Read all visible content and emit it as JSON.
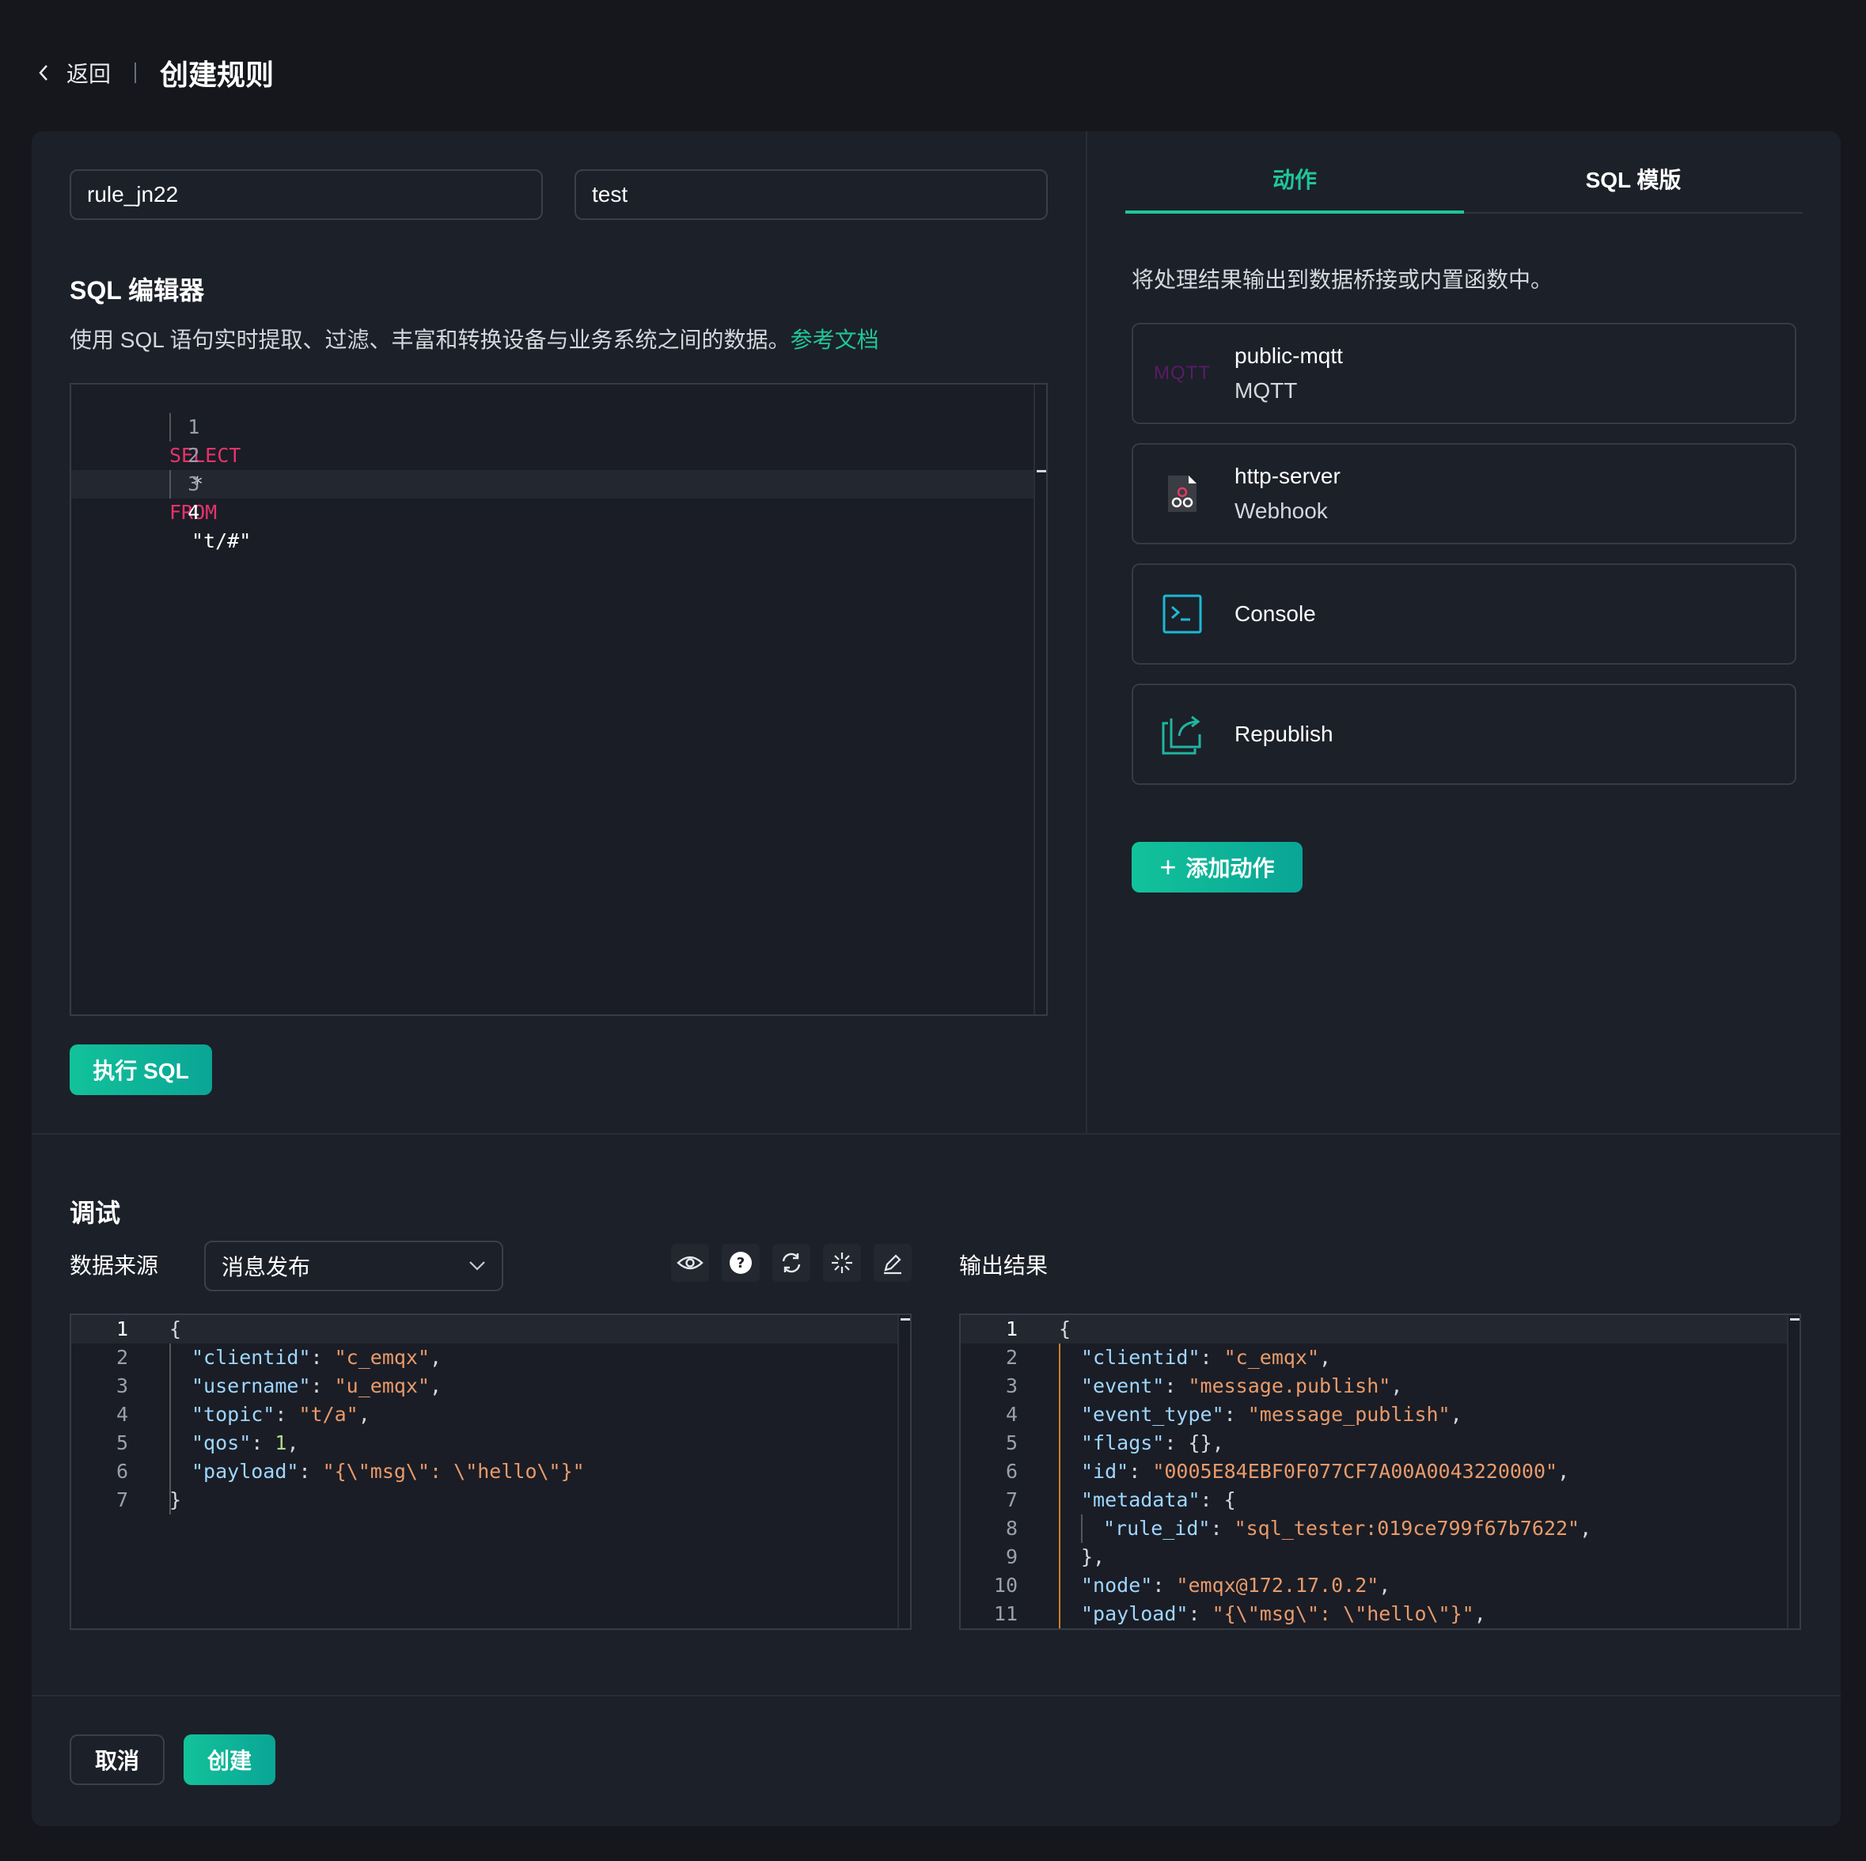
{
  "header": {
    "back_label": "返回",
    "title": "创建规则"
  },
  "rule": {
    "id": "rule_jn22",
    "description": "test"
  },
  "sql_editor": {
    "title": "SQL 编辑器",
    "description": "使用 SQL 语句实时提取、过滤、丰富和转换设备与业务系统之间的数据。",
    "doc_link": "参考文档",
    "lines": [
      {
        "n": "1",
        "text": "SELECT"
      },
      {
        "n": "2",
        "text": "*"
      },
      {
        "n": "3",
        "text": "FROM"
      },
      {
        "n": "4",
        "text": "\"t/#\""
      }
    ],
    "run_label": "执行 SQL"
  },
  "tabs": [
    {
      "label": "动作"
    },
    {
      "label": "SQL 模版"
    }
  ],
  "actions": {
    "description": "将处理结果输出到数据桥接或内置函数中。",
    "items": [
      {
        "name": "public-mqtt",
        "type": "MQTT",
        "icon_text": "MQTT",
        "icon": "mqtt-icon"
      },
      {
        "name": "http-server",
        "type": "Webhook",
        "icon": "webhook-icon"
      },
      {
        "name": "Console",
        "type": "",
        "icon": "terminal-icon"
      },
      {
        "name": "Republish",
        "type": "",
        "icon": "republish-icon"
      }
    ],
    "add_label": "添加动作"
  },
  "debug": {
    "title": "调试",
    "source_label": "数据来源",
    "source_value": "消息发布",
    "output_label": "输出结果",
    "input_lines": [
      {
        "n": "1",
        "key": "",
        "val": "",
        "raw": "{"
      },
      {
        "n": "2",
        "key": "\"clientid\"",
        "val": "\"c_emqx\"",
        "raw": ""
      },
      {
        "n": "3",
        "key": "\"username\"",
        "val": "\"u_emqx\"",
        "raw": ""
      },
      {
        "n": "4",
        "key": "\"topic\"",
        "val": "\"t/a\"",
        "raw": ""
      },
      {
        "n": "5",
        "key": "\"qos\"",
        "val": "1",
        "raw": ""
      },
      {
        "n": "6",
        "key": "\"payload\"",
        "val": "\"{\\\"msg\\\": \\\"hello\\\"}\"",
        "raw": ""
      },
      {
        "n": "7",
        "key": "",
        "val": "",
        "raw": "}"
      }
    ],
    "output_lines": [
      {
        "n": "1",
        "key": "",
        "val": "",
        "raw": "{"
      },
      {
        "n": "2",
        "key": "\"clientid\"",
        "val": "\"c_emqx\"",
        "raw": ""
      },
      {
        "n": "3",
        "key": "\"event\"",
        "val": "\"message.publish\"",
        "raw": ""
      },
      {
        "n": "4",
        "key": "\"event_type\"",
        "val": "\"message_publish\"",
        "raw": ""
      },
      {
        "n": "5",
        "key": "\"flags\"",
        "val": "{}",
        "raw": ""
      },
      {
        "n": "6",
        "key": "\"id\"",
        "val": "\"0005E84EBF0F077CF7A00A0043220000\"",
        "raw": ""
      },
      {
        "n": "7",
        "key": "\"metadata\"",
        "val": "{",
        "raw": ""
      },
      {
        "n": "8",
        "key": "\"rule_id\"",
        "val": "\"sql_tester:019ce799f67b7622\"",
        "raw": ""
      },
      {
        "n": "9",
        "key": "",
        "val": "",
        "raw": "},"
      },
      {
        "n": "10",
        "key": "\"node\"",
        "val": "\"emqx@172.17.0.2\"",
        "raw": ""
      },
      {
        "n": "11",
        "key": "\"payload\"",
        "val": "\"{\\\"msg\\\": \\\"hello\\\"}\"",
        "raw": ""
      }
    ]
  },
  "footer": {
    "cancel_label": "取消",
    "create_label": "创建"
  },
  "colors": {
    "accent": "#1fc69b",
    "keyword": "#e6336b",
    "string": "#e99a6b",
    "key": "#9fd6ff"
  }
}
